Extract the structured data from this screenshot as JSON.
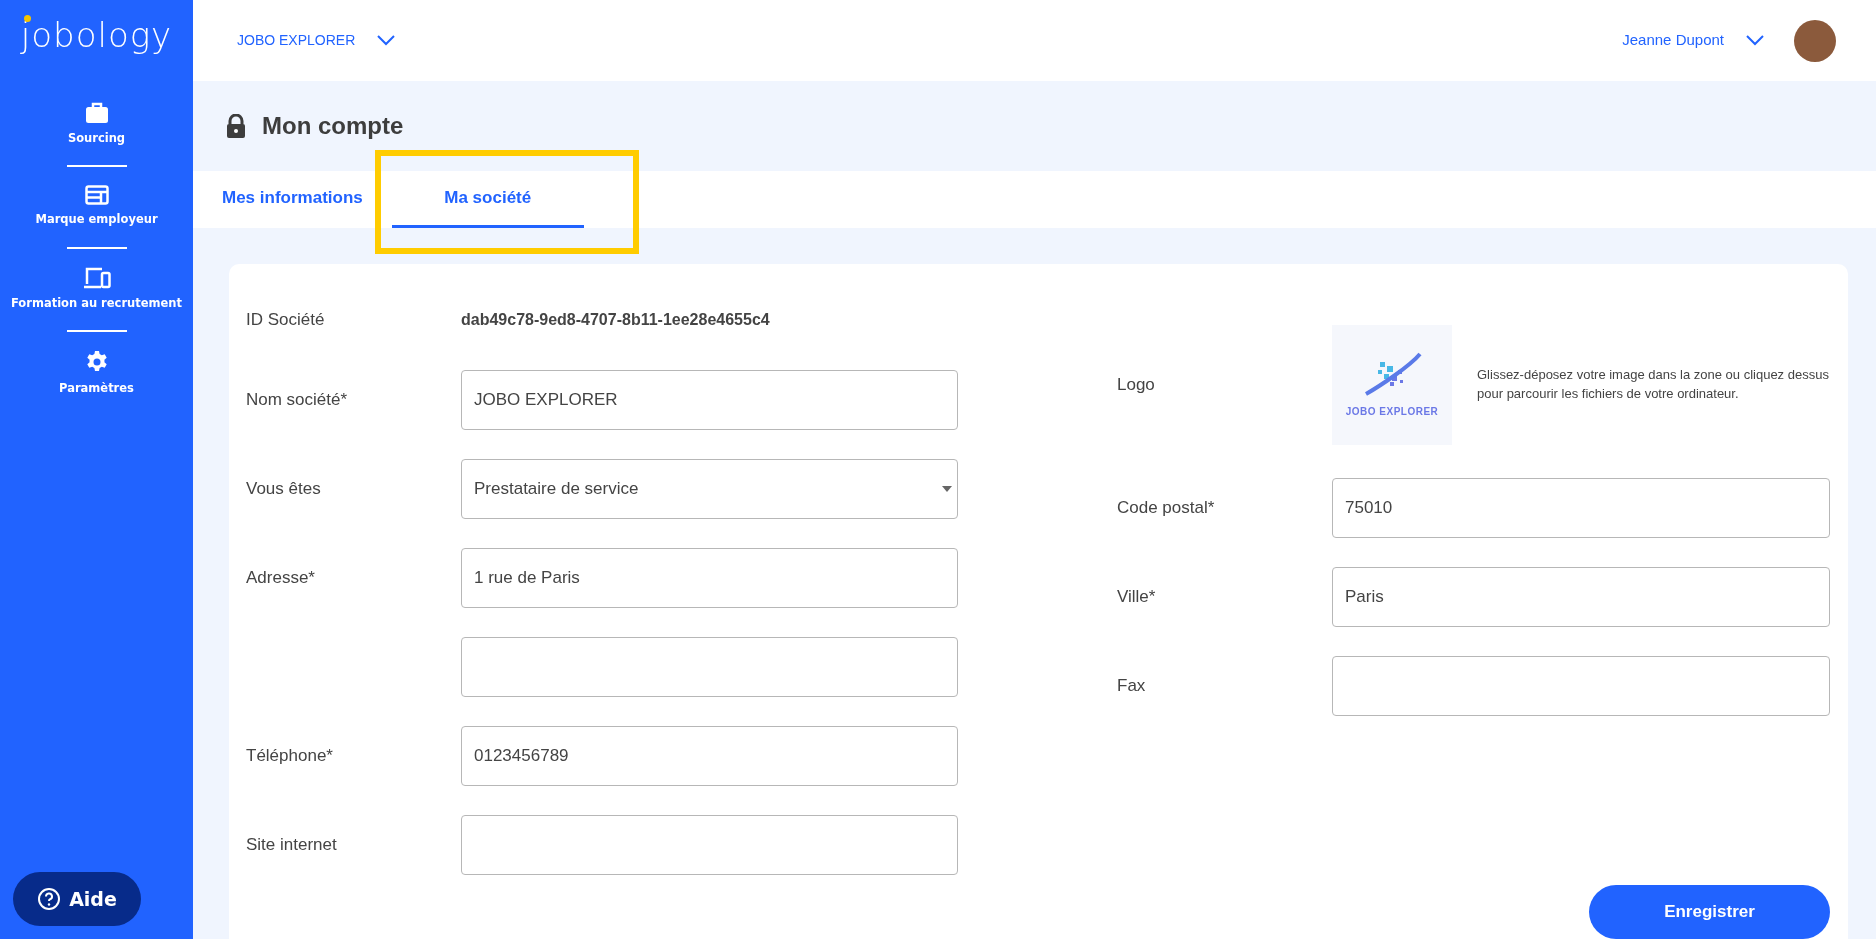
{
  "brand": "jobology",
  "sidebar": {
    "items": [
      {
        "kind": "briefcase",
        "label": "Sourcing"
      },
      {
        "kind": "layout",
        "label": "Marque employeur"
      },
      {
        "kind": "devices",
        "label": "Formation au recrutement"
      },
      {
        "kind": "gear",
        "label": "Paramètres"
      }
    ],
    "help_button": "Aide"
  },
  "header": {
    "company": "JOBO EXPLORER",
    "user": "Jeanne Dupont"
  },
  "page_title": "Mon compte",
  "tabs": [
    {
      "label": "Mes informations",
      "selected": false,
      "highlighted": false
    },
    {
      "label": "Ma société",
      "selected": true,
      "highlighted": true
    }
  ],
  "left_fields": [
    {
      "kind": "text",
      "label": "ID Société",
      "value": "dab49c78-9ed8-4707-8b11-1ee28e4655c4"
    },
    {
      "kind": "input",
      "label": "Nom société*",
      "value": "JOBO EXPLORER"
    },
    {
      "kind": "select",
      "label": "Vous êtes",
      "value": "Prestataire de service"
    },
    {
      "kind": "input",
      "label": "Adresse*",
      "value": "1 rue de Paris"
    },
    {
      "kind": "input"
    },
    {
      "kind": "input",
      "label": "Téléphone*",
      "value": "0123456789"
    },
    {
      "kind": "input",
      "label": "Site internet"
    }
  ],
  "right_fields": [
    {
      "kind": "logo",
      "label": "Logo",
      "logo_text": "JOBO EXPLORER",
      "hint": "Glissez-déposez votre image dans la zone ou cliquez dessus pour parcourir les fichiers de votre ordinateur."
    },
    {
      "kind": "input",
      "label": "Code postal*",
      "value": "75010"
    },
    {
      "kind": "input",
      "label": "Ville*",
      "value": "Paris"
    },
    {
      "kind": "input",
      "label": "Fax"
    }
  ],
  "save_button": "Enregistrer"
}
